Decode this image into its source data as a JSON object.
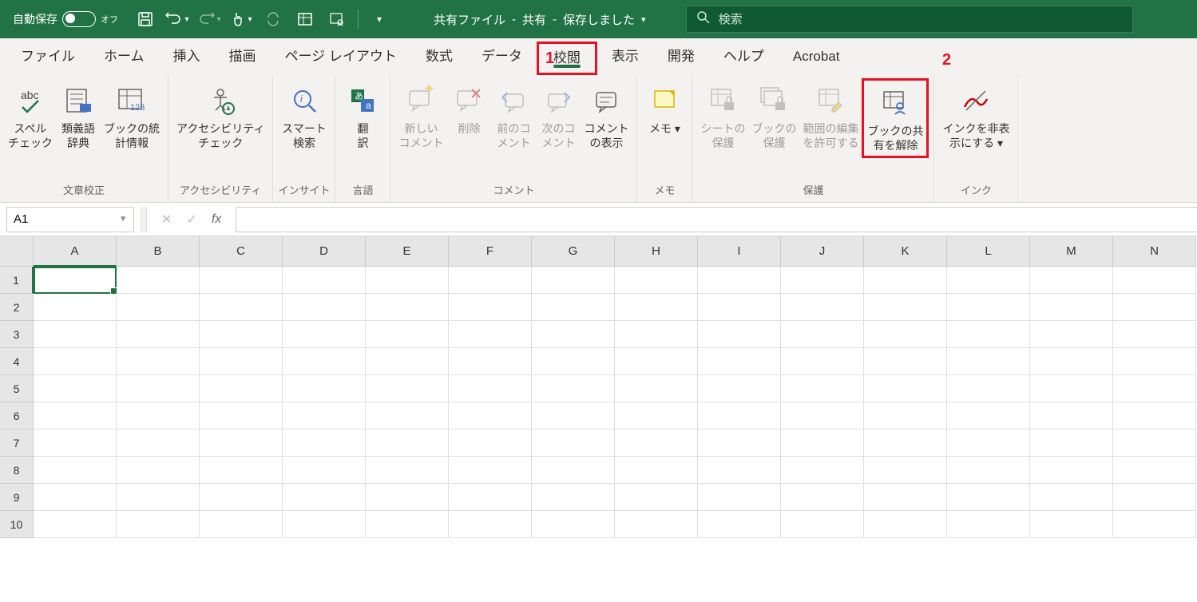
{
  "titleBar": {
    "autosave_label": "自動保存",
    "autosave_state": "オフ",
    "filename": "共有ファイル",
    "shared": "共有",
    "saved": "保存しました",
    "search_placeholder": "検索"
  },
  "tabs": [
    "ファイル",
    "ホーム",
    "挿入",
    "描画",
    "ページ レイアウト",
    "数式",
    "データ",
    "校閲",
    "表示",
    "開発",
    "ヘルプ",
    "Acrobat"
  ],
  "activeTab": "校閲",
  "annotations": {
    "one": "1",
    "two": "2"
  },
  "ribbon": {
    "groups": [
      {
        "label": "文章校正",
        "buttons": [
          {
            "key": "spell",
            "line1": "スペル",
            "line2": "チェック"
          },
          {
            "key": "thesaurus",
            "line1": "類義語",
            "line2": "辞典"
          },
          {
            "key": "stats",
            "line1": "ブックの統",
            "line2": "計情報"
          }
        ]
      },
      {
        "label": "アクセシビリティ",
        "buttons": [
          {
            "key": "a11y",
            "line1": "アクセシビリティ",
            "line2": "チェック"
          }
        ]
      },
      {
        "label": "インサイト",
        "buttons": [
          {
            "key": "smart",
            "line1": "スマート",
            "line2": "検索"
          }
        ]
      },
      {
        "label": "言語",
        "buttons": [
          {
            "key": "translate",
            "line1": "翻",
            "line2": "訳"
          }
        ]
      },
      {
        "label": "コメント",
        "buttons": [
          {
            "key": "newc",
            "line1": "新しい",
            "line2": "コメント",
            "disabled": true
          },
          {
            "key": "delc",
            "line1": "削除",
            "line2": "",
            "disabled": true
          },
          {
            "key": "prevc",
            "line1": "前のコ",
            "line2": "メント",
            "disabled": true
          },
          {
            "key": "nextc",
            "line1": "次のコ",
            "line2": "メント",
            "disabled": true
          },
          {
            "key": "showc",
            "line1": "コメント",
            "line2": "の表示"
          }
        ]
      },
      {
        "label": "メモ",
        "buttons": [
          {
            "key": "memo",
            "line1": "メモ",
            "line2": "",
            "dropdown": true
          }
        ]
      },
      {
        "label": "保護",
        "buttons": [
          {
            "key": "psheet",
            "line1": "シートの",
            "line2": "保護",
            "disabled": true
          },
          {
            "key": "pbook",
            "line1": "ブックの",
            "line2": "保護",
            "disabled": true
          },
          {
            "key": "pedit",
            "line1": "範囲の編集",
            "line2": "を許可する",
            "disabled": true
          },
          {
            "key": "unshare",
            "line1": "ブックの共",
            "line2": "有を解除",
            "boxed": true
          }
        ]
      },
      {
        "label": "インク",
        "buttons": [
          {
            "key": "ink",
            "line1": "インクを非表",
            "line2": "示にする",
            "dropdown": true
          }
        ]
      }
    ]
  },
  "formulaBar": {
    "nameBox": "A1",
    "fx": "fx"
  },
  "grid": {
    "cols": [
      "A",
      "B",
      "C",
      "D",
      "E",
      "F",
      "G",
      "H",
      "I",
      "J",
      "K",
      "L",
      "M",
      "N"
    ],
    "rows": [
      "1",
      "2",
      "3",
      "4",
      "5",
      "6",
      "7",
      "8",
      "9",
      "10"
    ],
    "selectedCell": "A1"
  }
}
